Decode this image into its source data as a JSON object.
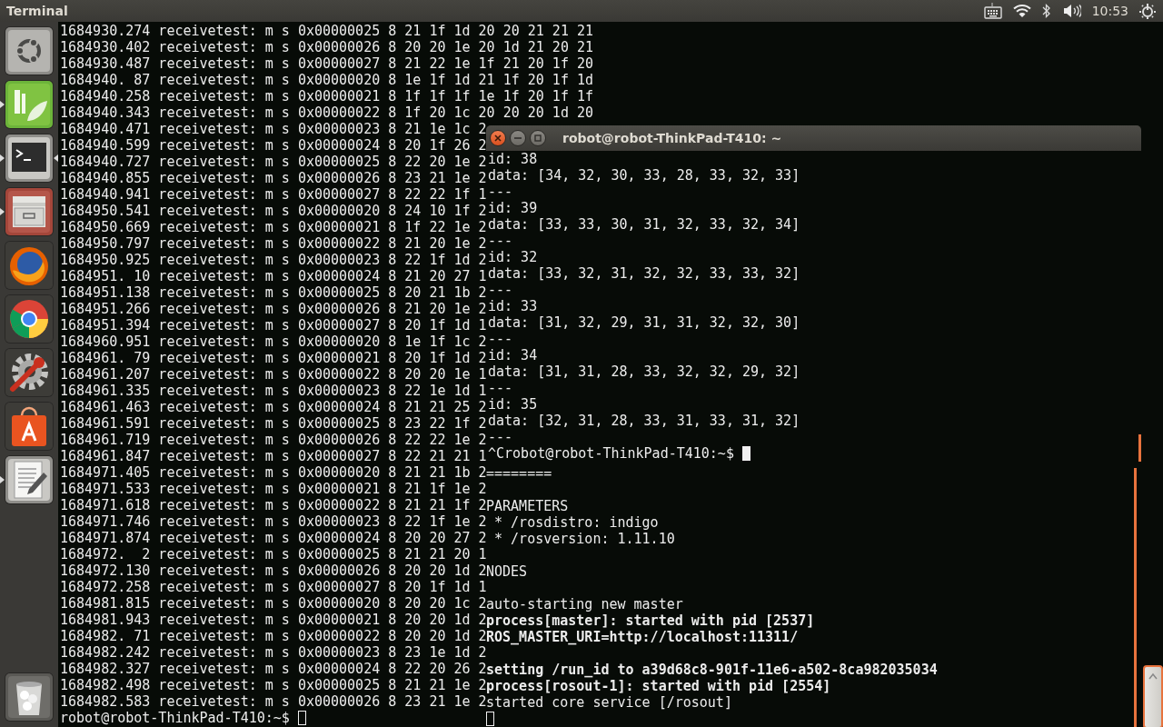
{
  "top_panel": {
    "app_title": "Terminal",
    "clock": "10:53"
  },
  "launcher": {
    "items": [
      {
        "kind": "dash",
        "running": false,
        "focused": false
      },
      {
        "kind": "qt",
        "running": true,
        "focused": false
      },
      {
        "kind": "terminal",
        "running": true,
        "focused": true
      },
      {
        "kind": "files",
        "running": true,
        "focused": false
      },
      {
        "kind": "firefox",
        "running": false,
        "focused": false
      },
      {
        "kind": "chrome",
        "running": false,
        "focused": false
      },
      {
        "kind": "settings",
        "running": false,
        "focused": false
      },
      {
        "kind": "store",
        "running": false,
        "focused": false
      },
      {
        "kind": "editor",
        "running": true,
        "focused": false
      }
    ],
    "bottom_items": [
      {
        "kind": "trash",
        "running": false,
        "focused": false
      }
    ]
  },
  "left_terminal": {
    "focused": false,
    "lines": [
      "1684930.274 receivetest: m s 0x00000025 8 21 1f 1d 20 20 21 21 21",
      "1684930.402 receivetest: m s 0x00000026 8 20 20 1e 20 1d 21 20 21",
      "1684930.487 receivetest: m s 0x00000027 8 21 22 1e 1f 21 20 1f 20",
      "1684940. 87 receivetest: m s 0x00000020 8 1e 1f 1d 21 1f 20 1f 1d",
      "1684940.258 receivetest: m s 0x00000021 8 1f 1f 1f 1e 1f 20 1f 1f",
      "1684940.343 receivetest: m s 0x00000022 8 1f 20 1c 20 20 20 1d 20",
      "1684940.471 receivetest: m s 0x00000023 8 21 1e 1c 2",
      "1684940.599 receivetest: m s 0x00000024 8 20 1f 26 2",
      "1684940.727 receivetest: m s 0x00000025 8 22 20 1e 2",
      "1684940.855 receivetest: m s 0x00000026 8 23 21 1e 2",
      "1684940.941 receivetest: m s 0x00000027 8 22 22 1f 1",
      "1684950.541 receivetest: m s 0x00000020 8 24 10 1f 2",
      "1684950.669 receivetest: m s 0x00000021 8 1f 22 1e 2",
      "1684950.797 receivetest: m s 0x00000022 8 21 20 1e 2",
      "1684950.925 receivetest: m s 0x00000023 8 22 1f 1d 2",
      "1684951. 10 receivetest: m s 0x00000024 8 21 20 27 1",
      "1684951.138 receivetest: m s 0x00000025 8 20 21 1b 2",
      "1684951.266 receivetest: m s 0x00000026 8 21 20 1e 2",
      "1684951.394 receivetest: m s 0x00000027 8 20 1f 1d 1",
      "1684960.951 receivetest: m s 0x00000020 8 1e 1f 1c 2",
      "1684961. 79 receivetest: m s 0x00000021 8 20 1f 1d 2",
      "1684961.207 receivetest: m s 0x00000022 8 20 20 1e 1",
      "1684961.335 receivetest: m s 0x00000023 8 22 1e 1d 1",
      "1684961.463 receivetest: m s 0x00000024 8 21 21 25 2",
      "1684961.591 receivetest: m s 0x00000025 8 23 22 1f 2",
      "1684961.719 receivetest: m s 0x00000026 8 22 22 1e 2",
      "1684961.847 receivetest: m s 0x00000027 8 22 21 21 1",
      "1684971.405 receivetest: m s 0x00000020 8 21 21 1b 2",
      "1684971.533 receivetest: m s 0x00000021 8 21 1f 1e 2",
      "1684971.618 receivetest: m s 0x00000022 8 21 21 1f 2",
      "1684971.746 receivetest: m s 0x00000023 8 22 1f 1e 2",
      "1684971.874 receivetest: m s 0x00000024 8 20 20 27 2",
      "1684972.  2 receivetest: m s 0x00000025 8 21 21 20 1",
      "1684972.130 receivetest: m s 0x00000026 8 20 20 1d 2",
      "1684972.258 receivetest: m s 0x00000027 8 20 1f 1d 1",
      "1684981.815 receivetest: m s 0x00000020 8 20 20 1c 2",
      "1684981.943 receivetest: m s 0x00000021 8 20 20 1d 2",
      "1684982. 71 receivetest: m s 0x00000022 8 20 20 1d 2",
      "1684982.242 receivetest: m s 0x00000023 8 23 1e 1d 2",
      "1684982.327 receivetest: m s 0x00000024 8 22 20 26 2",
      "1684982.498 receivetest: m s 0x00000025 8 21 21 1e 2",
      "1684982.583 receivetest: m s 0x00000026 8 23 21 1e 2"
    ],
    "prompt": "robot@robot-ThinkPad-T410:~$"
  },
  "front_window": {
    "title": "robot@robot-ThinkPad-T410: ~",
    "focused": true,
    "lines": [
      "id: 38",
      "data: [34, 32, 30, 33, 28, 33, 32, 33]",
      "---",
      "id: 39",
      "data: [33, 33, 30, 31, 32, 33, 32, 34]",
      "---",
      "id: 32",
      "data: [33, 32, 31, 32, 32, 33, 33, 32]",
      "---",
      "id: 33",
      "data: [31, 32, 29, 31, 31, 32, 32, 30]",
      "---",
      "id: 34",
      "data: [31, 31, 28, 33, 32, 32, 29, 32]",
      "---",
      "id: 35",
      "data: [32, 31, 28, 33, 31, 33, 31, 32]",
      "---"
    ],
    "prompt": "^Crobot@robot-ThinkPad-T410:~$"
  },
  "ros_terminal": {
    "focused": false,
    "lines": [
      {
        "kind": "text",
        "text": "========",
        "bold": false
      },
      {
        "kind": "blank"
      },
      {
        "kind": "text",
        "text": "PARAMETERS",
        "bold": false
      },
      {
        "kind": "text",
        "text": " * /rosdistro: indigo",
        "bold": false
      },
      {
        "kind": "text",
        "text": " * /rosversion: 1.11.10",
        "bold": false
      },
      {
        "kind": "blank"
      },
      {
        "kind": "text",
        "text": "NODES",
        "bold": false
      },
      {
        "kind": "blank"
      },
      {
        "kind": "text",
        "text": "auto-starting new master",
        "bold": false
      },
      {
        "kind": "text",
        "text": "process[master]: started with pid [2537]",
        "bold": true
      },
      {
        "kind": "text",
        "text": "ROS_MASTER_URI=http://localhost:11311/",
        "bold": true
      },
      {
        "kind": "blank"
      },
      {
        "kind": "text",
        "text": "setting /run_id to a39d68c8-901f-11e6-a502-8ca982035034",
        "bold": true
      },
      {
        "kind": "text",
        "text": "process[rosout-1]: started with pid [2554]",
        "bold": true
      },
      {
        "kind": "text",
        "text": "started core service [/rosout]",
        "bold": false
      }
    ]
  }
}
